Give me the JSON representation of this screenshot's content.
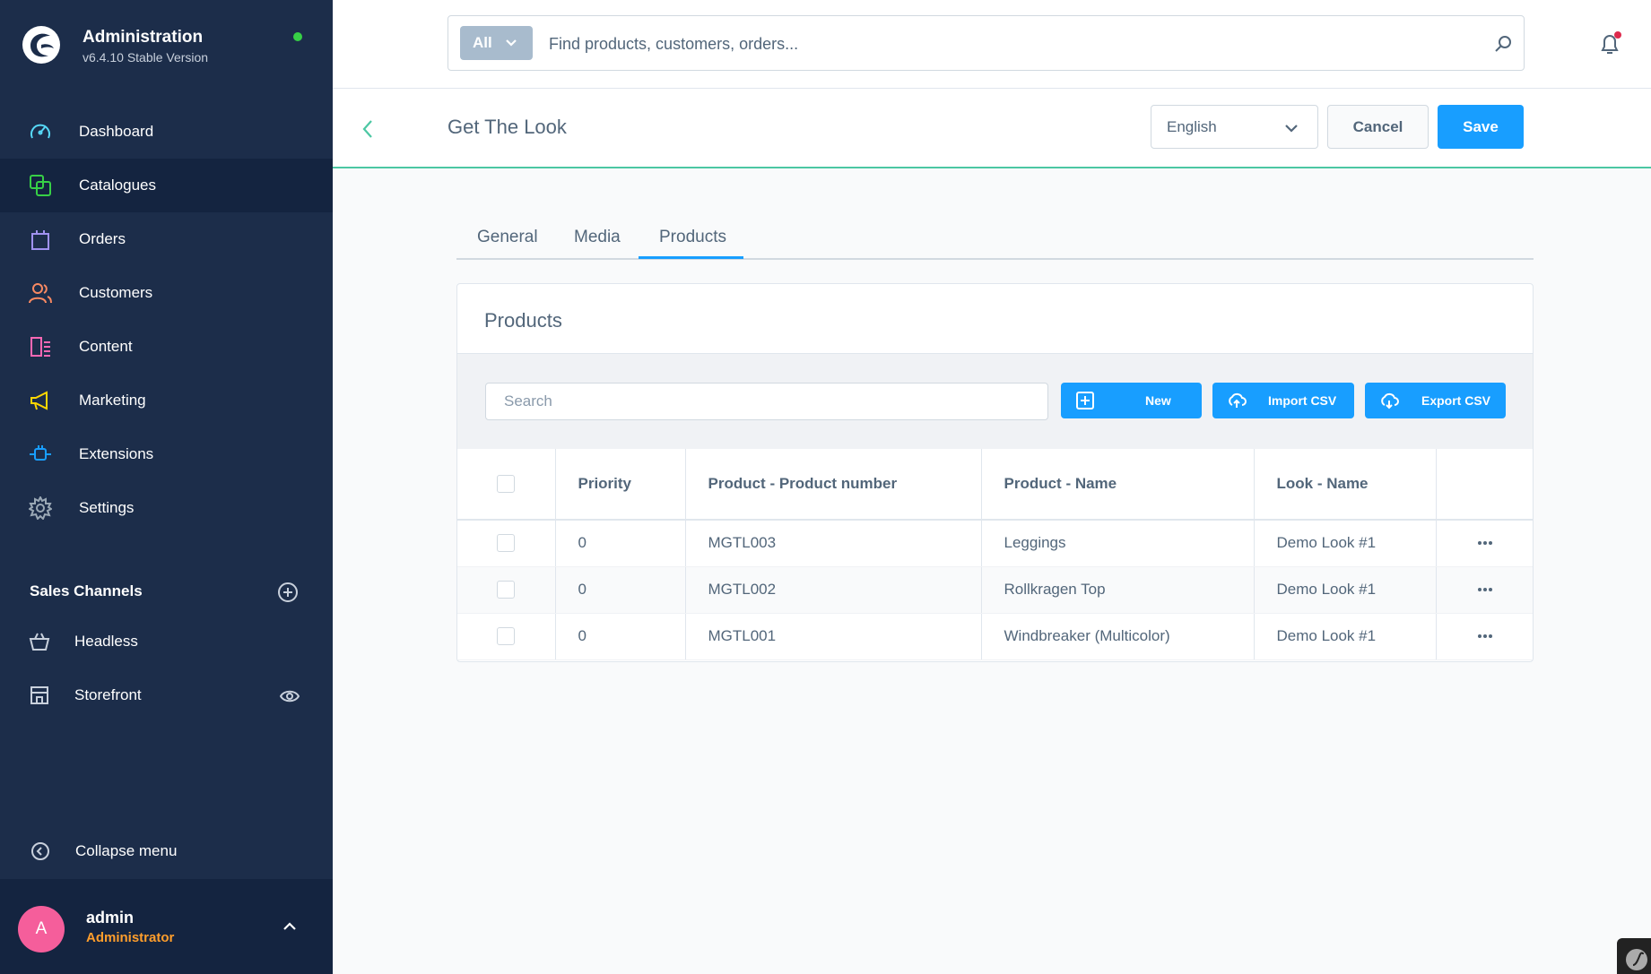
{
  "brand": {
    "title": "Administration",
    "version": "v6.4.10 Stable Version"
  },
  "nav": [
    {
      "label": "Dashboard",
      "icon": "dashboard-icon",
      "color": "#57d9f8"
    },
    {
      "label": "Catalogues",
      "icon": "catalogue-icon",
      "color": "#37d046"
    },
    {
      "label": "Orders",
      "icon": "orders-icon",
      "color": "#a092f0"
    },
    {
      "label": "Customers",
      "icon": "customers-icon",
      "color": "#f88962"
    },
    {
      "label": "Content",
      "icon": "content-icon",
      "color": "#ff68b4"
    },
    {
      "label": "Marketing",
      "icon": "marketing-icon",
      "color": "#ffd700"
    },
    {
      "label": "Extensions",
      "icon": "extensions-icon",
      "color": "#189eff"
    },
    {
      "label": "Settings",
      "icon": "settings-icon",
      "color": "#9aa8b5"
    }
  ],
  "sales_channels": {
    "header": "Sales Channels",
    "items": [
      {
        "label": "Headless"
      },
      {
        "label": "Storefront"
      }
    ]
  },
  "collapse_label": "Collapse menu",
  "user": {
    "initial": "A",
    "name": "admin",
    "role": "Administrator"
  },
  "search": {
    "type": "All",
    "placeholder": "Find products, customers, orders..."
  },
  "smartbar": {
    "title": "Get The Look",
    "language": "English",
    "cancel": "Cancel",
    "save": "Save"
  },
  "tabs": [
    {
      "label": "General"
    },
    {
      "label": "Media"
    },
    {
      "label": "Products"
    }
  ],
  "card": {
    "title": "Products",
    "search_placeholder": "Search",
    "buttons": {
      "new": "New",
      "import": "Import CSV",
      "export": "Export CSV"
    },
    "columns": [
      "Priority",
      "Product - Product number",
      "Product - Name",
      "Look - Name"
    ],
    "rows": [
      {
        "priority": "0",
        "number": "MGTL003",
        "name": "Leggings",
        "look": "Demo Look #1"
      },
      {
        "priority": "0",
        "number": "MGTL002",
        "name": "Rollkragen Top",
        "look": "Demo Look #1"
      },
      {
        "priority": "0",
        "number": "MGTL001",
        "name": "Windbreaker (Multicolor)",
        "look": "Demo Look #1"
      }
    ]
  },
  "colors": {
    "sidebar": "#1c2d4a",
    "primary": "#189eff",
    "accent_line": "#4cc7a3",
    "role": "#ff9e2c",
    "avatar": "#f55e9b"
  }
}
